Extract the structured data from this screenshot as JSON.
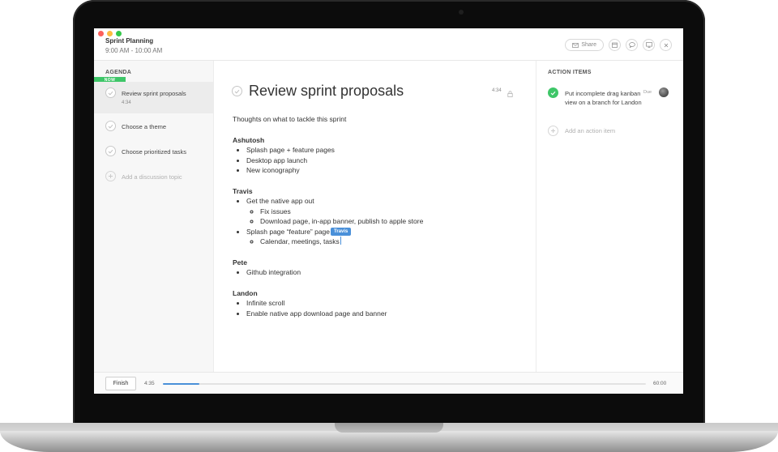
{
  "window": {
    "title": "Sprint Planning",
    "time_range": "9:00 AM - 10:00 AM",
    "share_label": "Share",
    "icons": [
      "calendar-icon",
      "comment-icon",
      "present-icon",
      "close-icon"
    ]
  },
  "agenda": {
    "heading": "AGENDA",
    "now_badge": "NOW",
    "items": [
      {
        "label": "Review sprint proposals",
        "timer": "4:34",
        "active": true
      },
      {
        "label": "Choose a theme"
      },
      {
        "label": "Choose prioritized tasks"
      }
    ],
    "add_placeholder": "Add a discussion topic"
  },
  "topic": {
    "title": "Review sprint proposals",
    "timer": "4:34",
    "intro": "Thoughts on what to tackle this sprint",
    "sections": [
      {
        "person": "Ashutosh",
        "items": [
          "Splash page + feature pages",
          "Desktop app launch",
          "New iconography"
        ]
      },
      {
        "person": "Travis",
        "items": [
          "Get the native app out",
          "Fix issues",
          "Download page, in-app banner, publish to apple store",
          "Splash page “feature” page",
          "Calendar, meetings, tasks"
        ]
      },
      {
        "person": "Pete",
        "items": [
          "Github integration"
        ]
      },
      {
        "person": "Landon",
        "items": [
          "Infinite scroll",
          "Enable native app download page and banner"
        ]
      }
    ],
    "cursor_user": "Travis"
  },
  "action_items": {
    "heading": "ACTION ITEMS",
    "items": [
      {
        "text": "Put incomplete drag kanban view on a branch for Landon",
        "due_label": "Due",
        "done": true
      }
    ],
    "add_placeholder": "Add an action item"
  },
  "footer": {
    "finish_label": "Finish",
    "elapsed": "4:35",
    "total": "60:00",
    "progress_fraction": 0.076
  },
  "colors": {
    "accent_green": "#3ec668",
    "accent_blue": "#4a90d9"
  }
}
